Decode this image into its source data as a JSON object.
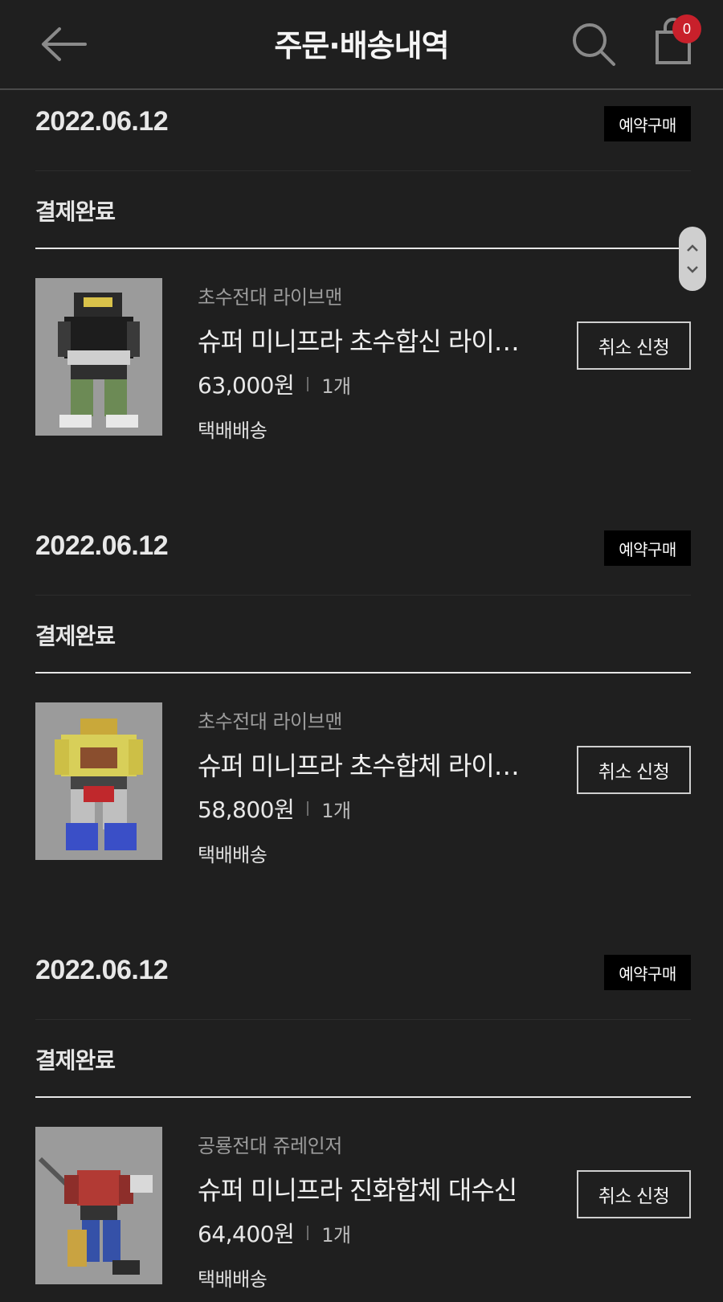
{
  "header": {
    "title": "주문·배송내역",
    "cart_count": "0",
    "icons": [
      "back-arrow-icon",
      "search-icon",
      "shopping-bag-icon"
    ]
  },
  "orders": [
    {
      "date": "2022.06.12",
      "tag": "예약구매",
      "status": "결제완료",
      "item": {
        "brand": "초수전대 라이브맨",
        "name": "슈퍼 미니프라 초수합신 라이…",
        "price": "63,000원",
        "qty": "1개",
        "shipping": "택배배송",
        "cancel_label": "취소 신청"
      }
    },
    {
      "date": "2022.06.12",
      "tag": "예약구매",
      "status": "결제완료",
      "item": {
        "brand": "초수전대 라이브맨",
        "name": "슈퍼 미니프라 초수합체 라이…",
        "price": "58,800원",
        "qty": "1개",
        "shipping": "택배배송",
        "cancel_label": "취소 신청"
      }
    },
    {
      "date": "2022.06.12",
      "tag": "예약구매",
      "status": "결제완료",
      "item": {
        "brand": "공룡전대 쥬레인저",
        "name": "슈퍼 미니프라 진화합체 대수신",
        "price": "64,400원",
        "qty": "1개",
        "shipping": "택배배송",
        "cancel_label": "취소 신청"
      }
    }
  ],
  "colors": {
    "background": "#1f1f1f",
    "badge": "#c8202b",
    "tag_bg": "#000000"
  }
}
